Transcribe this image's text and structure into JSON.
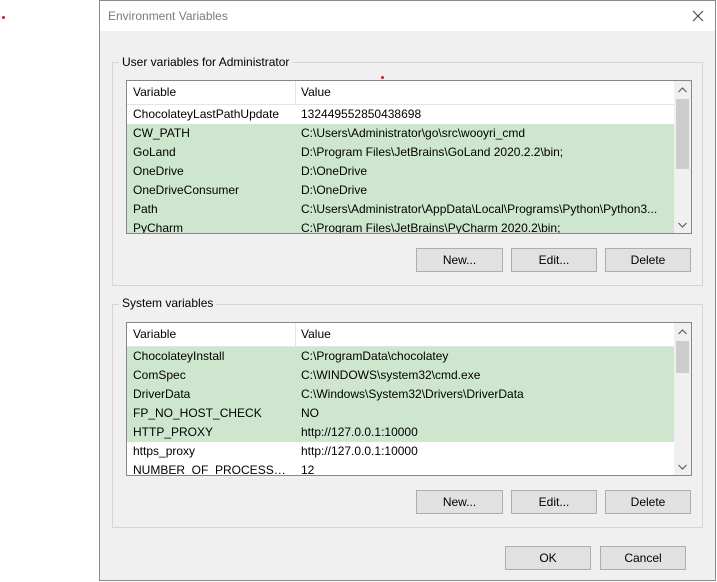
{
  "dialog": {
    "title": "Environment Variables"
  },
  "user_vars": {
    "label": "User variables for Administrator",
    "headers": {
      "name": "Variable",
      "value": "Value"
    },
    "rows": [
      {
        "name": "ChocolateyLastPathUpdate",
        "value": "132449552850438698"
      },
      {
        "name": "CW_PATH",
        "value": "C:\\Users\\Administrator\\go\\src\\wooyri_cmd"
      },
      {
        "name": "GoLand",
        "value": "D:\\Program Files\\JetBrains\\GoLand 2020.2.2\\bin;"
      },
      {
        "name": "OneDrive",
        "value": "D:\\OneDrive"
      },
      {
        "name": "OneDriveConsumer",
        "value": "D:\\OneDrive"
      },
      {
        "name": "Path",
        "value": "C:\\Users\\Administrator\\AppData\\Local\\Programs\\Python\\Python3..."
      },
      {
        "name": "PyCharm",
        "value": "C:\\Program Files\\JetBrains\\PyCharm 2020.2\\bin;"
      }
    ],
    "buttons": {
      "new": "New...",
      "edit": "Edit...",
      "delete": "Delete"
    }
  },
  "system_vars": {
    "label": "System variables",
    "headers": {
      "name": "Variable",
      "value": "Value"
    },
    "rows": [
      {
        "name": "ChocolateyInstall",
        "value": "C:\\ProgramData\\chocolatey"
      },
      {
        "name": "ComSpec",
        "value": "C:\\WINDOWS\\system32\\cmd.exe"
      },
      {
        "name": "DriverData",
        "value": "C:\\Windows\\System32\\Drivers\\DriverData"
      },
      {
        "name": "FP_NO_HOST_CHECK",
        "value": "NO"
      },
      {
        "name": "HTTP_PROXY",
        "value": "http://127.0.0.1:10000"
      },
      {
        "name": "https_proxy",
        "value": "http://127.0.0.1:10000"
      },
      {
        "name": "NUMBER_OF_PROCESSORS",
        "value": "12"
      }
    ],
    "buttons": {
      "new": "New...",
      "edit": "Edit...",
      "delete": "Delete"
    }
  },
  "footer": {
    "ok": "OK",
    "cancel": "Cancel"
  },
  "colors": {
    "highlight_row": "#cde6cd",
    "dialog_bg": "#f0f0f0",
    "stray_dot": "#e81123"
  },
  "icons": {
    "close": "close-icon",
    "scroll_up": "chevron-up-icon",
    "scroll_down": "chevron-down-icon"
  }
}
